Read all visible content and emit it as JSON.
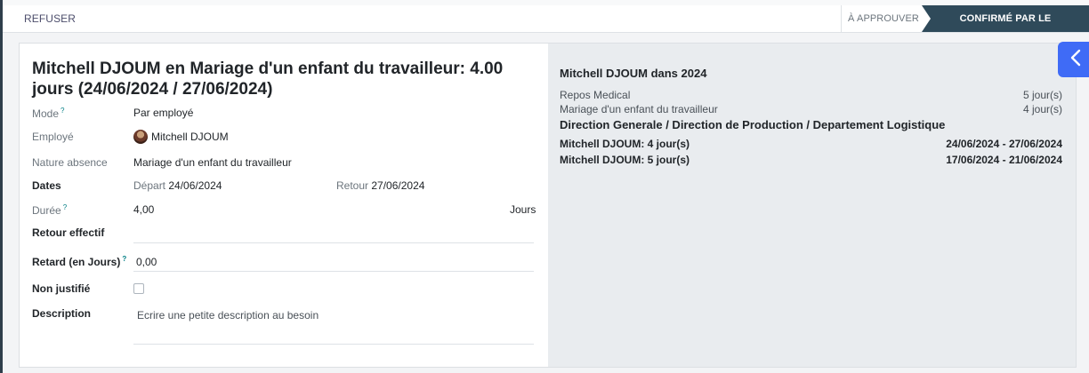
{
  "header": {
    "refuse_label": "REFUSER",
    "stages": [
      {
        "label": "À APPROUVER",
        "active": false
      },
      {
        "label": "CONFIRMÉ PAR LE RESPONSABLE",
        "active": true
      }
    ]
  },
  "form": {
    "title_line1": "Mitchell DJOUM en Mariage d'un enfant du travailleur: 4.00",
    "title_line2": "jours (24/06/2024 / 27/06/2024)",
    "mode": {
      "label": "Mode",
      "help": "?",
      "value": "Par employé"
    },
    "employee": {
      "label": "Employé",
      "value": "Mitchell DJOUM"
    },
    "leave_type": {
      "label": "Nature absence",
      "value": "Mariage d'un enfant du travailleur"
    },
    "dates": {
      "label": "Dates",
      "start_label": "Départ",
      "start": "24/06/2024",
      "end_label": "Retour",
      "end": "27/06/2024"
    },
    "duration": {
      "label": "Durée",
      "help": "?",
      "value": "4,00",
      "unit": "Jours"
    },
    "actual_return": {
      "label": "Retour effectif",
      "value": ""
    },
    "delay": {
      "label": "Retard (en Jours)",
      "help": "?",
      "value": "0,00"
    },
    "unjustified": {
      "label": "Non justifié",
      "checked": false
    },
    "description": {
      "label": "Description",
      "value": "Ecrire une petite description au besoin"
    }
  },
  "side_panel": {
    "title": "Mitchell DJOUM dans 2024",
    "summary": [
      {
        "name": "Repos Medical",
        "value": "5 jour(s)"
      },
      {
        "name": "Mariage d'un enfant du travailleur",
        "value": "4 jour(s)"
      }
    ],
    "department": "Direction Generale / Direction de Production / Departement Logistique",
    "entries": [
      {
        "name": "Mitchell DJOUM: 4 jour(s)",
        "dates": "24/06/2024 - 27/06/2024"
      },
      {
        "name": "Mitchell DJOUM: 5 jour(s)",
        "dates": "17/06/2024 - 21/06/2024"
      }
    ]
  },
  "colors": {
    "accent_blue": "#3f6bf6",
    "stage_active": "#2f4a5a",
    "side_panel_bg": "#e9ecef"
  },
  "icons": {
    "side_toggle": "chevron-left-icon",
    "employee_avatar": "avatar"
  }
}
